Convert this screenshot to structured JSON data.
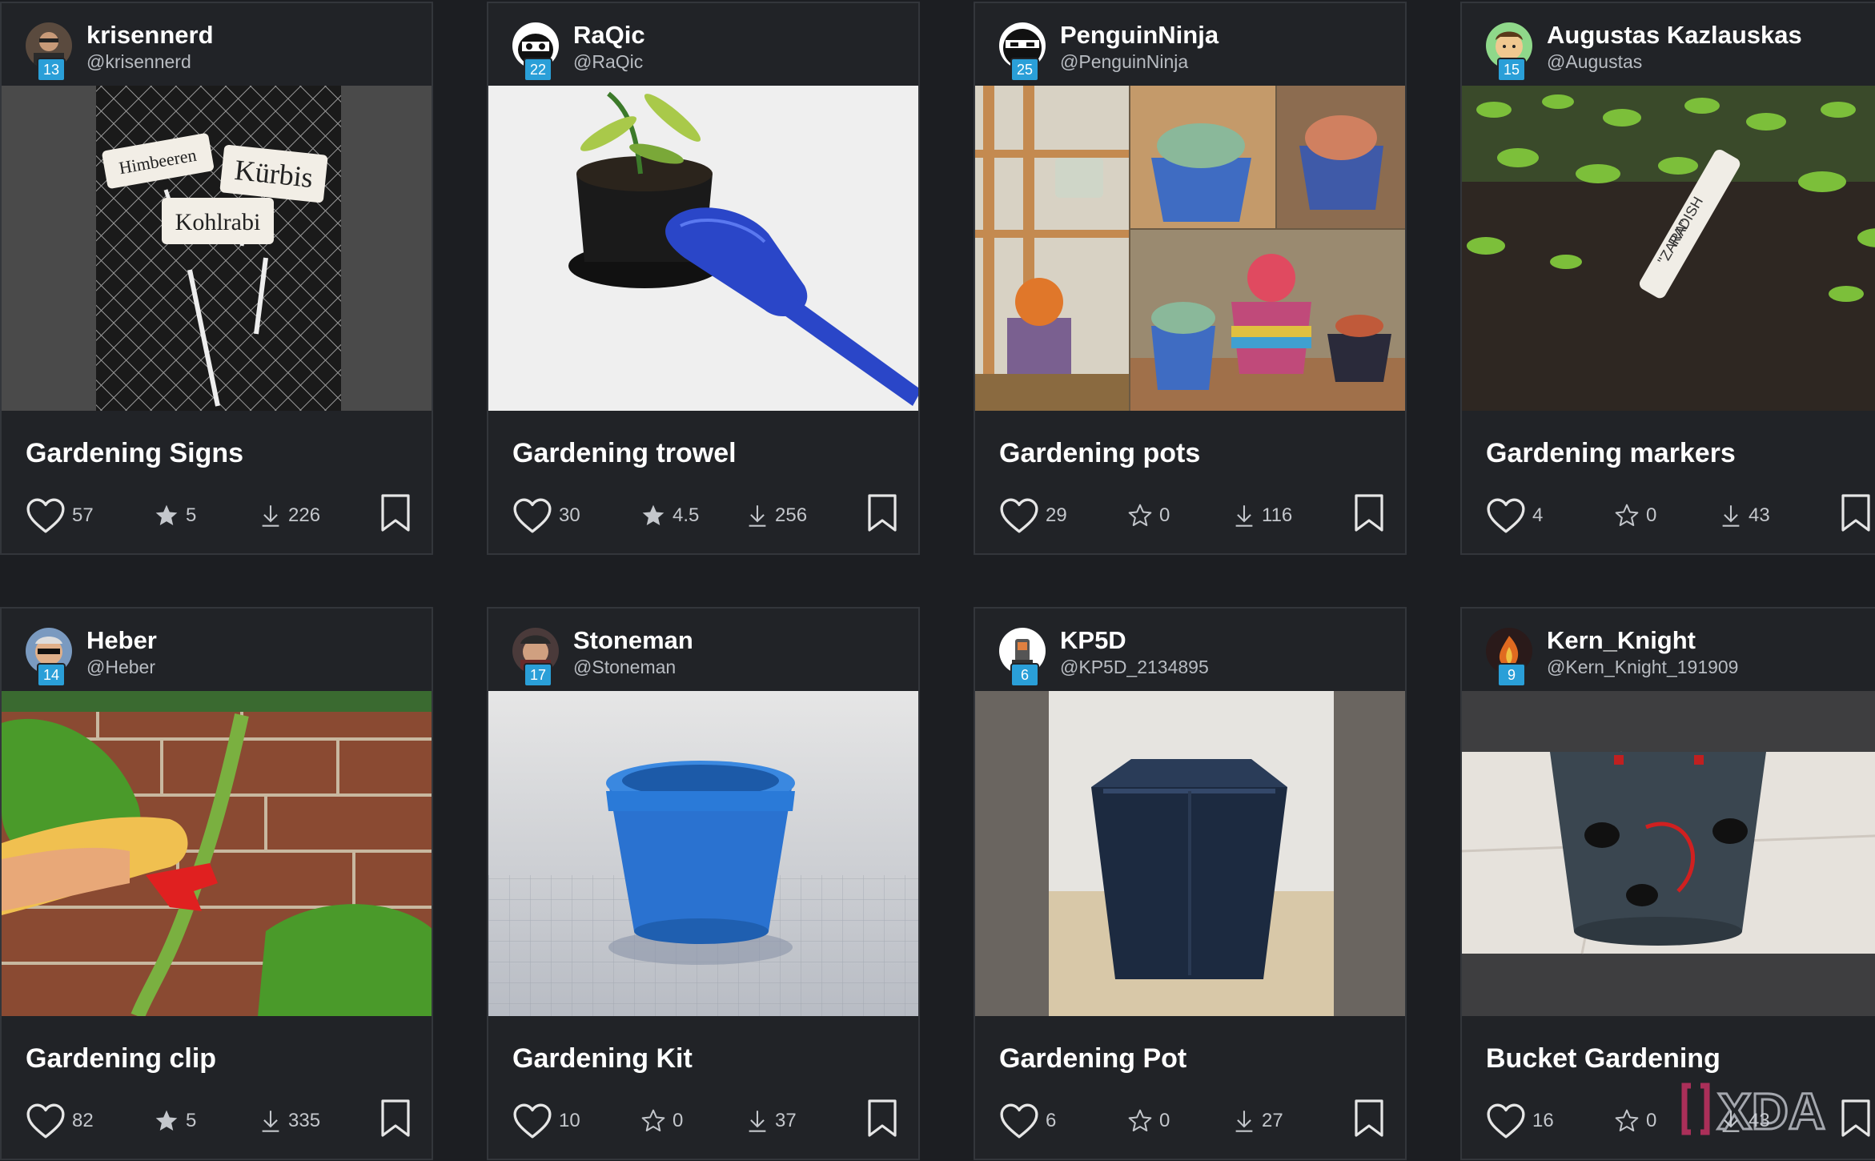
{
  "colors": {
    "background": "#1c1e22",
    "card": "#212327",
    "badge": "#2a9fd8",
    "text": "#ffffff",
    "muted": "#b8bcc2"
  },
  "cards": [
    {
      "author": "krisennerd",
      "handle": "@krisennerd",
      "level": "13",
      "title": "Gardening Signs",
      "likes": "57",
      "rating": "5",
      "rating_filled": true,
      "downloads": "226",
      "image_text": [
        "Himbeeren",
        "Kürbis",
        "Kohlrabi"
      ]
    },
    {
      "author": "RaQic",
      "handle": "@RaQic",
      "level": "22",
      "title": "Gardening trowel",
      "likes": "30",
      "rating": "4.5",
      "rating_filled": true,
      "downloads": "256"
    },
    {
      "author": "PenguinNinja",
      "handle": "@PenguinNinja",
      "level": "25",
      "title": "Gardening pots",
      "likes": "29",
      "rating": "0",
      "rating_filled": false,
      "downloads": "116"
    },
    {
      "author": "Augustas Kazlauskas",
      "handle": "@Augustas",
      "level": "15",
      "title": "Gardening markers",
      "likes": "4",
      "rating": "0",
      "rating_filled": false,
      "downloads": "43",
      "image_text": [
        "RADISH",
        "\"ZARA\""
      ]
    },
    {
      "author": "Heber",
      "handle": "@Heber",
      "level": "14",
      "title": "Gardening clip",
      "likes": "82",
      "rating": "5",
      "rating_filled": true,
      "downloads": "335"
    },
    {
      "author": "Stoneman",
      "handle": "@Stoneman",
      "level": "17",
      "title": "Gardening Kit",
      "likes": "10",
      "rating": "0",
      "rating_filled": false,
      "downloads": "37"
    },
    {
      "author": "KP5D",
      "handle": "@KP5D_2134895",
      "level": "6",
      "title": "Gardening Pot",
      "likes": "6",
      "rating": "0",
      "rating_filled": false,
      "downloads": "27"
    },
    {
      "author": "Kern_Knight",
      "handle": "@Kern_Knight_191909",
      "level": "9",
      "title": "Bucket Gardening",
      "likes": "16",
      "rating": "0",
      "rating_filled": false,
      "downloads": "43"
    }
  ],
  "watermark": "XDA"
}
